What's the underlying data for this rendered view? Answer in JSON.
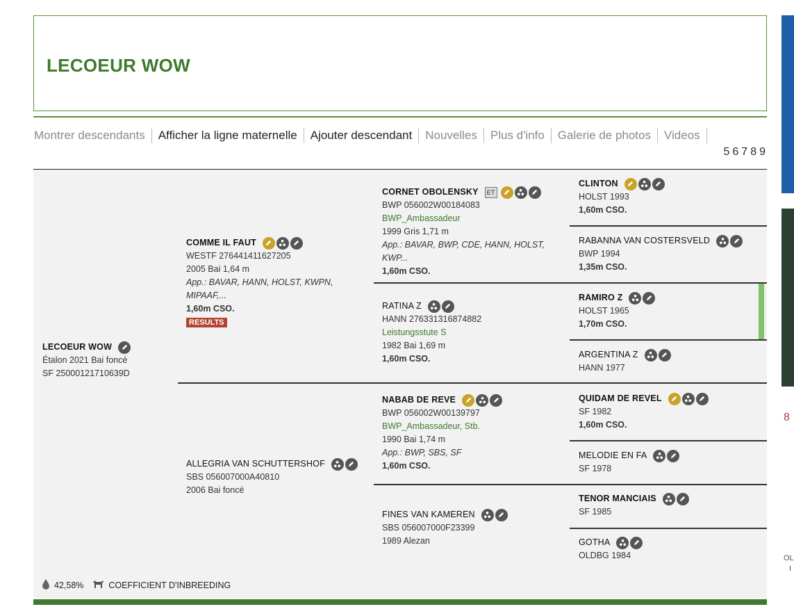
{
  "header": {
    "title": "LECOEUR WOW"
  },
  "nav": {
    "items": [
      {
        "label": "Montrer descendants",
        "style": "muted"
      },
      {
        "label": "Afficher la ligne maternelle",
        "style": "dark"
      },
      {
        "label": "Ajouter descendant",
        "style": "dark"
      },
      {
        "label": "Nouvelles",
        "style": "muted"
      },
      {
        "label": "Plus d'info",
        "style": "muted"
      },
      {
        "label": "Galerie de photos",
        "style": "muted"
      },
      {
        "label": "Videos",
        "style": "muted"
      }
    ],
    "pages": [
      "5",
      "6",
      "7",
      "8",
      "9"
    ]
  },
  "subject": {
    "name": "LECOEUR WOW",
    "line1": "Étalon 2021 Bai foncé",
    "line2": "SF 25000121710639D"
  },
  "sire": {
    "name": "COMME IL FAUT",
    "line1": "WESTF 276441411627205",
    "line2": "2005 Bai 1,64 m",
    "approvals": "App.: BAVAR, HANN, HOLST, KWPN, MIPAAF,...",
    "performance": "1,60m CSO.",
    "results": "RESULTS"
  },
  "dam": {
    "name": "ALLEGRIA VAN SCHUTTERSHOF",
    "line1": "SBS 056007000A40810",
    "line2": "2006 Bai foncé"
  },
  "ss": {
    "name": "CORNET OBOLENSKY",
    "badge": "ET",
    "line1": "BWP 056002W00184083",
    "stud": "BWP_Ambassadeur",
    "line2": "1999 Gris 1,71 m",
    "approvals": "App.: BAVAR, BWP, CDE, HANN, HOLST, KWP...",
    "performance": "1,60m CSO."
  },
  "sd": {
    "name": "RATINA Z",
    "line1": "HANN 276331316874882",
    "stud": "Leistungsstute S",
    "line2": "1982 Bai 1,69 m",
    "performance": "1,60m CSO."
  },
  "ds": {
    "name": "NABAB DE REVE",
    "line1": "BWP 056002W00139797",
    "stud": "BWP_Ambassadeur, Stb.",
    "line2": "1990 Bai 1,74 m",
    "approvals": "App.: BWP, SBS, SF",
    "performance": "1,60m CSO."
  },
  "dd": {
    "name": "FINES VAN KAMEREN",
    "line1": "SBS 056007000F23399",
    "line2": "1989 Alezan"
  },
  "g3": [
    {
      "name": "CLINTON",
      "line1": "HOLST 1993",
      "performance": "1,60m CSO."
    },
    {
      "name": "RABANNA VAN COSTERSVELD",
      "line1": "BWP 1994",
      "performance": "1,35m CSO."
    },
    {
      "name": "RAMIRO Z",
      "line1": "HOLST 1965",
      "performance": "1,70m CSO."
    },
    {
      "name": "ARGENTINA Z",
      "line1": "HANN 1977",
      "performance": ""
    },
    {
      "name": "QUIDAM DE REVEL",
      "line1": "SF 1982",
      "performance": "1,60m CSO."
    },
    {
      "name": "MELODIE EN FA",
      "line1": "SF 1978",
      "performance": ""
    },
    {
      "name": "TENOR MANCIAIS",
      "line1": "SF 1985",
      "performance": ""
    },
    {
      "name": "GOTHA",
      "line1": "OLDBG 1984",
      "performance": ""
    }
  ],
  "footer": {
    "percent": "42,58%",
    "label": "COEFFICIENT D'INBREEDING"
  },
  "right_fragments": {
    "a": "8",
    "b": "OL",
    "c": "I"
  },
  "colors": {
    "brand_green": "#3e7a2c",
    "results_red": "#b3442f",
    "icon_gold": "#c9a227"
  }
}
